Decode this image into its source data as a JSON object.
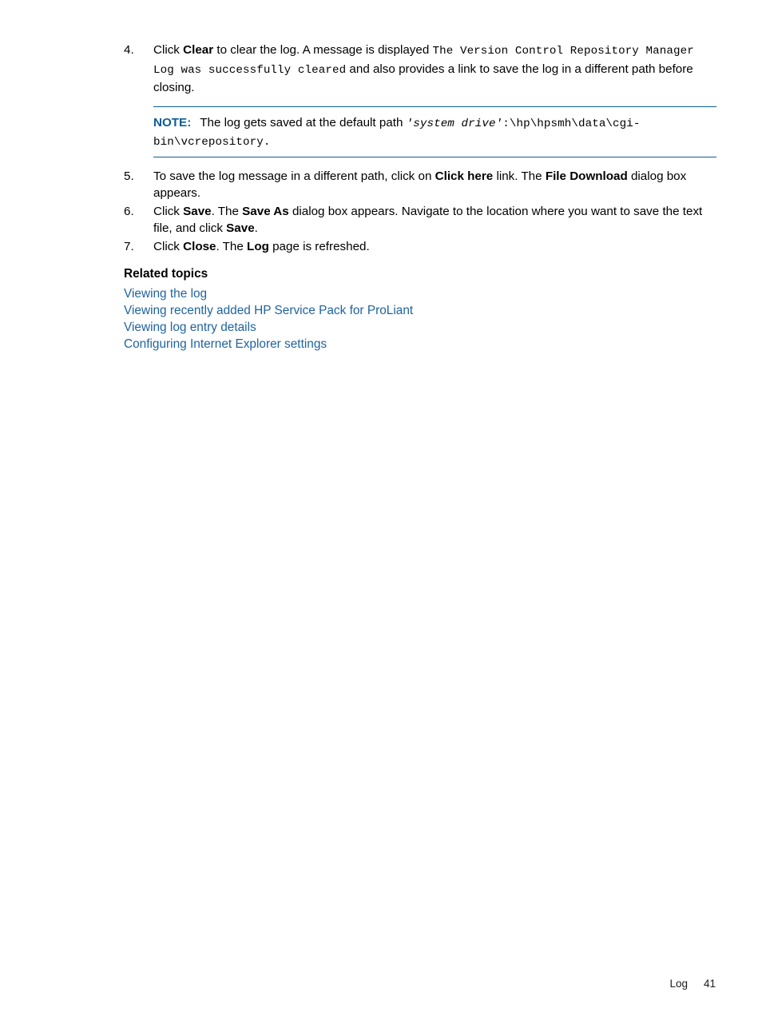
{
  "page": {
    "background": "#ffffff",
    "text_color": "#000000",
    "accent_color": "#0d5c94",
    "link_color": "#1f63a0"
  },
  "steps": [
    {
      "number": "4.",
      "parts": [
        {
          "type": "text",
          "text": "Click "
        },
        {
          "type": "bold",
          "text": "Clear"
        },
        {
          "type": "text",
          "text": " to clear the log. A message is displayed "
        },
        {
          "type": "mono",
          "text": "The Version Control Repository Manager Log was successfully cleared"
        },
        {
          "type": "text",
          "text": " and also provides a link to save the log in a different path before closing."
        }
      ]
    },
    {
      "number": "5.",
      "parts": [
        {
          "type": "text",
          "text": "To save the log message in a different path, click on "
        },
        {
          "type": "bold",
          "text": "Click here"
        },
        {
          "type": "text",
          "text": " link. The "
        },
        {
          "type": "bold",
          "text": "File Download"
        },
        {
          "type": "text",
          "text": " dialog box appears."
        }
      ]
    },
    {
      "number": "6.",
      "parts": [
        {
          "type": "text",
          "text": "Click "
        },
        {
          "type": "bold",
          "text": "Save"
        },
        {
          "type": "text",
          "text": ". The "
        },
        {
          "type": "bold",
          "text": "Save As"
        },
        {
          "type": "text",
          "text": " dialog box appears. Navigate to the location where you want to save the text file, and click "
        },
        {
          "type": "bold",
          "text": "Save"
        },
        {
          "type": "text",
          "text": "."
        }
      ]
    },
    {
      "number": "7.",
      "parts": [
        {
          "type": "text",
          "text": "Click "
        },
        {
          "type": "bold",
          "text": "Close"
        },
        {
          "type": "text",
          "text": ". The "
        },
        {
          "type": "bold",
          "text": "Log"
        },
        {
          "type": "text",
          "text": " page is refreshed."
        }
      ]
    }
  ],
  "note": {
    "label": "NOTE:",
    "parts": [
      {
        "type": "text",
        "text": "The log gets saved at the default path "
      },
      {
        "type": "mono-italic",
        "text": "'system drive'"
      },
      {
        "type": "mono",
        "text": ":\\hp\\hpsmh\\data\\cgi-bin\\vcrepository."
      }
    ]
  },
  "related": {
    "heading": "Related topics",
    "links": [
      "Viewing the log",
      "Viewing recently added HP Service Pack for ProLiant",
      "Viewing log entry details",
      "Configuring Internet Explorer settings"
    ]
  },
  "footer": {
    "chapter": "Log",
    "page_number": "41"
  }
}
